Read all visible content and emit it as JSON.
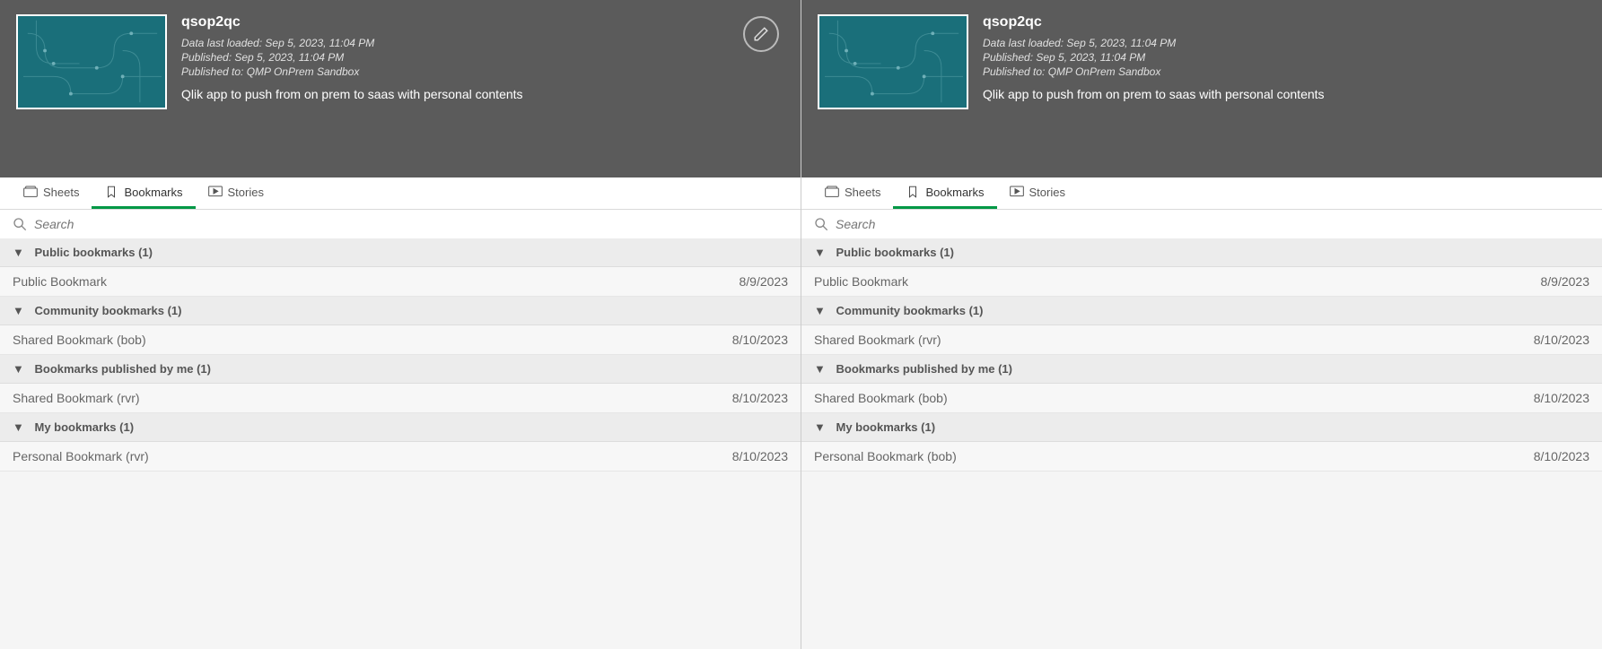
{
  "left": {
    "title": "qsop2qc",
    "dataLoaded": "Data last loaded: Sep 5, 2023, 11:04 PM",
    "published": "Published: Sep 5, 2023, 11:04 PM",
    "publishedTo": "Published to: QMP OnPrem Sandbox",
    "description": "Qlik app to push from on prem to saas with personal contents",
    "tabs": {
      "sheets": "Sheets",
      "bookmarks": "Bookmarks",
      "stories": "Stories"
    },
    "searchPlaceholder": "Search",
    "sections": {
      "public": {
        "header": "Public bookmarks (1)",
        "item": {
          "name": "Public Bookmark",
          "date": "8/9/2023"
        }
      },
      "community": {
        "header": "Community bookmarks (1)",
        "item": {
          "name": "Shared Bookmark (bob)",
          "date": "8/10/2023"
        }
      },
      "mine": {
        "header": "Bookmarks published by me (1)",
        "item": {
          "name": "Shared Bookmark (rvr)",
          "date": "8/10/2023"
        }
      },
      "my": {
        "header": "My bookmarks (1)",
        "item": {
          "name": "Personal Bookmark (rvr)",
          "date": "8/10/2023"
        }
      }
    }
  },
  "right": {
    "title": "qsop2qc",
    "dataLoaded": "Data last loaded: Sep 5, 2023, 11:04 PM",
    "published": "Published: Sep 5, 2023, 11:04 PM",
    "publishedTo": "Published to: QMP OnPrem Sandbox",
    "description": "Qlik app to push from on prem to saas with personal contents",
    "tabs": {
      "sheets": "Sheets",
      "bookmarks": "Bookmarks",
      "stories": "Stories"
    },
    "searchPlaceholder": "Search",
    "sections": {
      "public": {
        "header": "Public bookmarks (1)",
        "item": {
          "name": "Public Bookmark",
          "date": "8/9/2023"
        }
      },
      "community": {
        "header": "Community bookmarks (1)",
        "item": {
          "name": "Shared Bookmark (rvr)",
          "date": "8/10/2023"
        }
      },
      "mine": {
        "header": "Bookmarks published by me (1)",
        "item": {
          "name": "Shared Bookmark (bob)",
          "date": "8/10/2023"
        }
      },
      "my": {
        "header": "My bookmarks (1)",
        "item": {
          "name": "Personal Bookmark (bob)",
          "date": "8/10/2023"
        }
      }
    }
  }
}
